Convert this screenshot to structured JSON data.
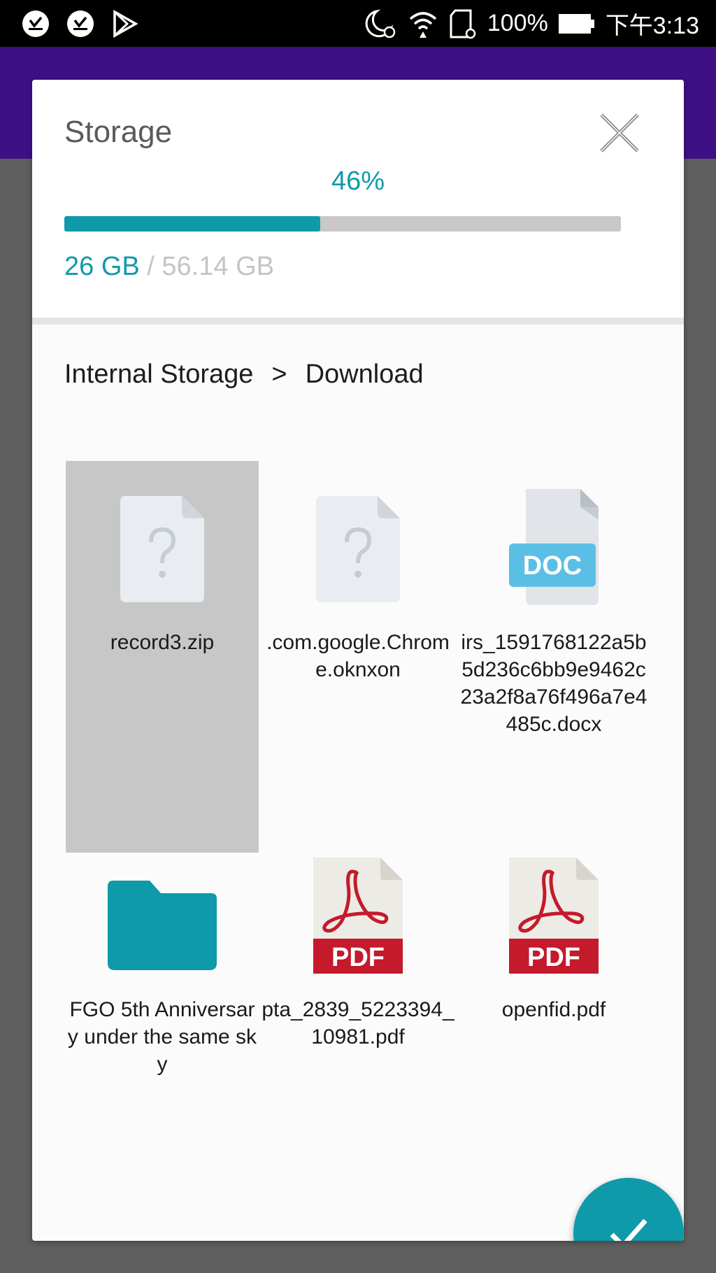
{
  "status_bar": {
    "battery_percent": "100%",
    "time": "下午3:13",
    "icons": [
      "download-done-icon",
      "download-done-icon",
      "play-store-icon",
      "alarm-moon-icon",
      "wifi-icon",
      "sd-card-icon",
      "battery-icon"
    ]
  },
  "dialog": {
    "title": "Storage",
    "usage_percent_label": "46%",
    "usage_fraction": 0.46,
    "used": "26 GB",
    "separator": " / ",
    "total": "56.14 GB",
    "breadcrumb": {
      "root": "Internal Storage",
      "separator": ">",
      "current": "Download"
    },
    "files": [
      {
        "name": "record3.zip",
        "icon": "unknown-file-icon",
        "selected": true
      },
      {
        "name": ".com.google.Chrome.oknxon",
        "icon": "unknown-file-icon",
        "selected": false
      },
      {
        "name": "irs_1591768122a5b5d236c6bb9e9462c23a2f8a76f496a7e4485c.docx",
        "icon": "doc-file-icon",
        "selected": false
      },
      {
        "name": "FGO 5th Anniversary under the same sky",
        "icon": "folder-icon",
        "selected": false
      },
      {
        "name": "pta_2839_5223394_10981.pdf",
        "icon": "pdf-file-icon",
        "selected": false
      },
      {
        "name": "openfid.pdf",
        "icon": "pdf-file-icon",
        "selected": false
      }
    ],
    "doc_badge": "DOC",
    "pdf_badge": "PDF"
  },
  "colors": {
    "accent": "#0f9aaa",
    "app_bar": "#3f0f86",
    "pdf_red": "#c41a2b",
    "doc_blue": "#5bbfe5",
    "selected_bg": "#c7c7c7"
  }
}
